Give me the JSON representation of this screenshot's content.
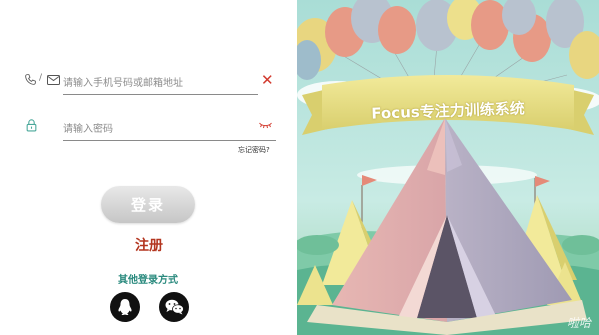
{
  "login_form": {
    "account_placeholder": "请输入手机号码或邮箱地址",
    "password_placeholder": "请输入密码",
    "forgot_password_label": "忘记密码?",
    "login_button_label": "登录",
    "register_label": "注册",
    "other_login_title": "其他登录方式",
    "social_logins": [
      {
        "name": "QQ",
        "icon": "qq-penguin-icon"
      },
      {
        "name": "WeChat",
        "icon": "wechat-icon"
      }
    ]
  },
  "banner": {
    "title": "Focus专注力训练系统",
    "watermark": "啦哈"
  },
  "colors": {
    "accent_red": "#d23a2e",
    "register_red": "#b3351f",
    "teal_text": "#2a8a7e",
    "icon_teal": "#4aa89a",
    "sky": "#b6e3dc"
  }
}
